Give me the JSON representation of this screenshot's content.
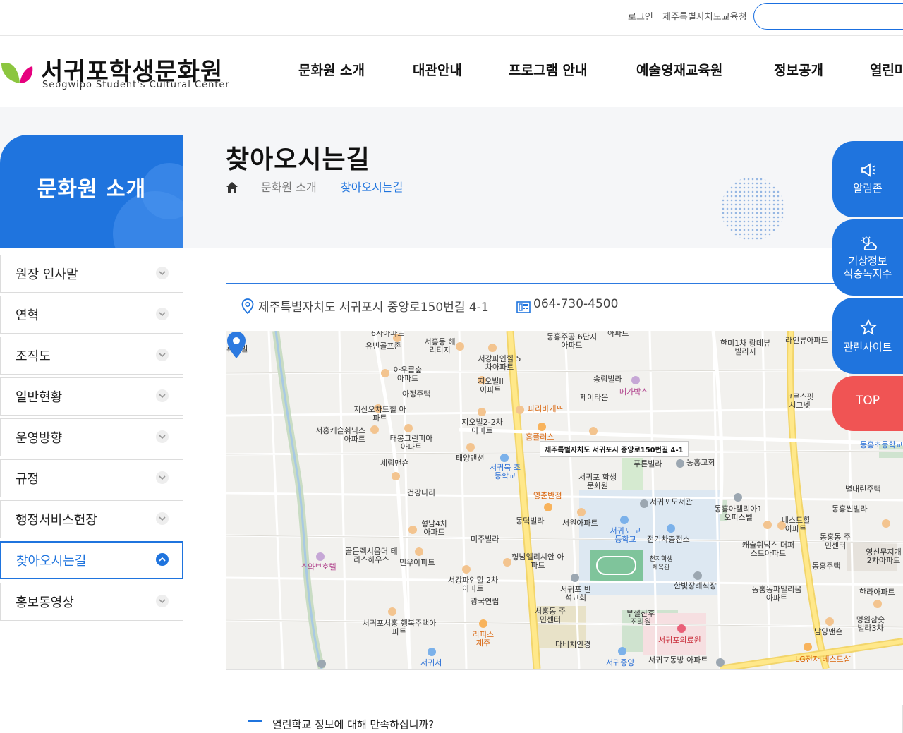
{
  "utility": {
    "login": "로그인",
    "office": "제주특별자치도교육청",
    "search_placeholder": ""
  },
  "logo": {
    "name_ko": "서귀포학생문화원",
    "name_en": "Seogwipo Student's Cultural Center"
  },
  "gnb": [
    "문화원 소개",
    "대관안내",
    "프로그램 안내",
    "예술영재교육원",
    "정보공개",
    "열린마"
  ],
  "lnb": {
    "title": "문화원 소개",
    "items": [
      "원장 인사말",
      "연혁",
      "조직도",
      "일반현황",
      "운영방향",
      "규정",
      "행정서비스헌장",
      "찾아오시는길",
      "홍보동영상"
    ],
    "active": "찾아오시는길"
  },
  "page": {
    "title": "찾아오시는길",
    "breadcrumb": [
      "문화원 소개",
      "찾아오시는길"
    ]
  },
  "location": {
    "address": "제주특별자치도 서귀포시 중앙로150번길 4-1",
    "phone": "064-730-4500",
    "marker_label": "제주특별자치도 서귀포시 중앙로150번길 4-1"
  },
  "map_labels": [
    "휴먼빌",
    "6사아파트",
    "유빈골프존",
    "서홍동 헤리티지",
    "서강파인힐 5차아파트",
    "동홍주공 6단지아파트",
    "아파트",
    "한미1차 랑데뷰빌리지",
    "라인뷰아파트",
    "아우름숲 아파트",
    "아정주택",
    "지오빌II 아파트",
    "송림빌라",
    "메가박스",
    "제이타운",
    "크로스핏 시그넷",
    "지산오차드힐 아파트",
    "파리바게뜨",
    "서홍캐슬휘닉스 아파트",
    "태봉그린피아 아파트",
    "지오빌2-2차 아파트",
    "홈플러스",
    "세림맨숀",
    "태양맨션",
    "서귀북 초등학교",
    "푸른빌라",
    "동홍교회",
    "동홍초등학교",
    "건강나라",
    "영춘반점",
    "서귀포 학생문화원",
    "별내린주택",
    "서귀포도서관",
    "동홍아젤리아1 오피스텔",
    "동홍썬빌라",
    "형남4차 아파트",
    "동덕빌라",
    "서원아파트",
    "서귀포 고등학교",
    "전기차충전소",
    "네스트힐 아파트",
    "동홍동 주민센터",
    "골든렉시움더 테라스하우스",
    "스와브호텔",
    "민우아파트",
    "미주빌라",
    "형남엘리시안 아파트",
    "천지학생 체육관",
    "캐슬휘닉스 더퍼스트아파트",
    "동홍주택",
    "영신무지개 2차아파트",
    "서강파인힐 2차아파트",
    "광국연립",
    "서귀포 반석교회",
    "한빛장례식장",
    "동홍동파밀리움 아파트",
    "한라아파트",
    "서홍동 주민센터",
    "서귀포서홍 행복주택아파트",
    "라피스 제주",
    "부설산후 조리원",
    "남양맨숀",
    "명원참숏 빌라3차",
    "다비치안경",
    "서귀포의료원",
    "서귀중앙",
    "서귀포동방 아파트",
    "LG전자 베스트샵",
    "서귀서"
  ],
  "quick": {
    "notice": "알림존",
    "weather": [
      "기상정보",
      "식중독지수"
    ],
    "related": "관련사이트",
    "top": "TOP"
  },
  "bottom": {
    "text": "열린학교 정보에 대해 만족하십니까?"
  },
  "colors": {
    "primary": "#1f74de",
    "top_button": "#f05454",
    "logo_green": "#8cc63f",
    "logo_pink": "#e6007e"
  }
}
